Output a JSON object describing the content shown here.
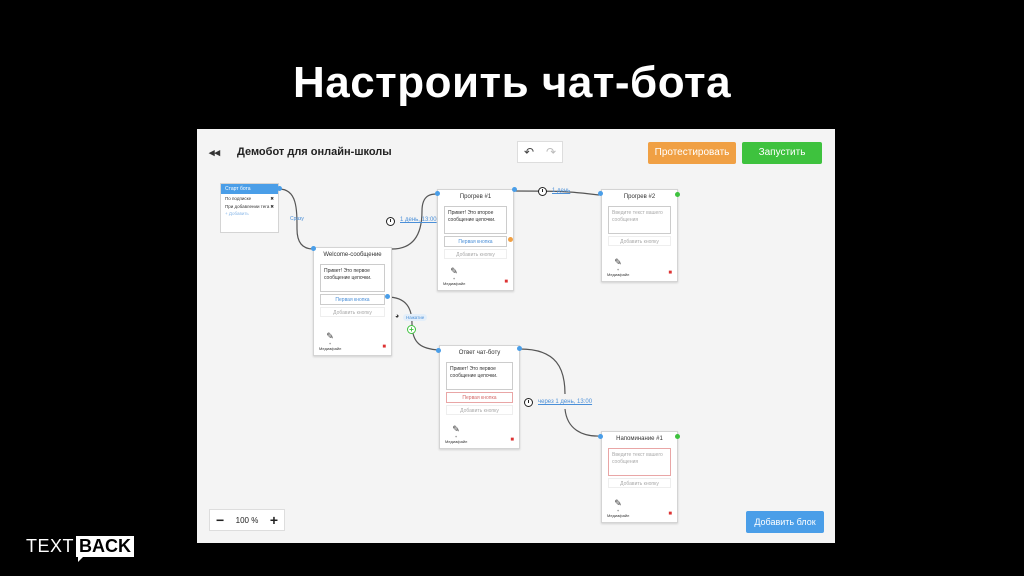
{
  "slide": {
    "title": "Настроить чат-бота"
  },
  "logo": {
    "text": "TEXT",
    "box": "BACK"
  },
  "topbar": {
    "back_icon": "◂◂",
    "bot_name": "Демобот для онлайн-школы",
    "undo_icon": "↶",
    "redo_icon": "↷",
    "test_label": "Протестировать",
    "run_label": "Запустить"
  },
  "start_block": {
    "title": "Старт бота",
    "rows": [
      {
        "label": "По подписке",
        "mark": "✖"
      },
      {
        "label": "При добавлении тега",
        "mark": "✖"
      }
    ],
    "add_label": "+ Добавить"
  },
  "links": {
    "start_to_welcome": "Сразу",
    "welcome_to_reply": "Нажатие"
  },
  "delays": {
    "d1": "1 день, 13:00",
    "d2": "1 день",
    "d3": "через 1 день, 13:00"
  },
  "blocks": {
    "welcome": {
      "title": "Welcome-сообщение",
      "text": "Привет! Это первое сообщение цепочки.",
      "button": "Первая кнопка",
      "add_button": "Добавить кнопку",
      "attach": "+ Медиафайл"
    },
    "warmup1": {
      "title": "Прогрев #1",
      "text": "Привет! Это второе сообщение цепочки.",
      "button": "Первая кнопка",
      "add_button": "Добавить кнопку",
      "attach": "+ Медиафайл"
    },
    "warmup2": {
      "title": "Прогрев #2",
      "placeholder": "Введите текст вашего сообщения",
      "add_button": "Добавить кнопку",
      "attach": "+ Медиафайл"
    },
    "reply": {
      "title": "Ответ чат-боту",
      "text": "Привет! Это первое сообщение цепочки.",
      "button": "Первая кнопка",
      "add_button": "Добавить кнопку",
      "attach": "+ Медиафайл"
    },
    "reminder": {
      "title": "Напоминание #1",
      "placeholder": "Введите текст вашего сообщения",
      "add_button": "Добавить кнопку",
      "attach": "+ Медиафайл"
    }
  },
  "zoom": {
    "minus": "−",
    "level": "100 %",
    "plus": "+"
  },
  "add_block_label": "Добавить блок",
  "colors": {
    "accent": "#4a9ee8",
    "test": "#f0a044",
    "run": "#3ec23e",
    "background": "#f4f4f4"
  }
}
